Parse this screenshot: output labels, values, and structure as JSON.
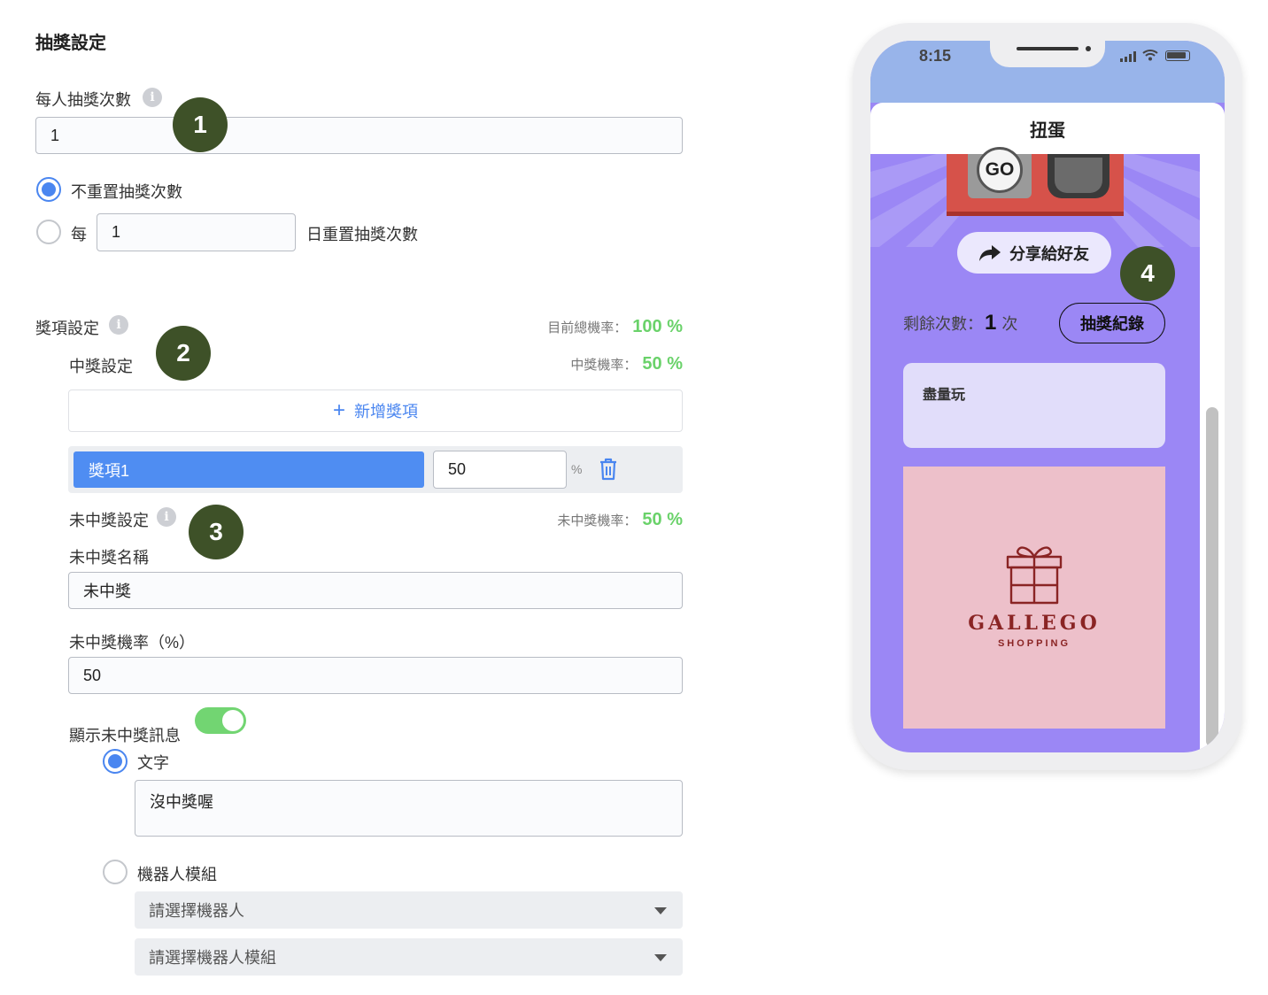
{
  "section_title": "抽獎設定",
  "draw_count": {
    "label": "每人抽獎次數",
    "value": "1",
    "option_no_reset": "不重置抽獎次數",
    "option_reset_prefix": "每",
    "reset_days_value": "1",
    "option_reset_suffix": "日重置抽獎次數"
  },
  "prize_settings": {
    "title": "獎項設定",
    "total_rate_label": "目前總機率：",
    "total_rate_value": "100 %",
    "win_title": "中獎設定",
    "win_rate_label": "中獎機率：",
    "win_rate_value": "50 %",
    "add_prize_label": "新增獎項",
    "prizes": [
      {
        "name": "獎項1",
        "rate": "50",
        "unit": "%"
      }
    ]
  },
  "no_win": {
    "title": "未中獎設定",
    "rate_label": "未中獎機率：",
    "rate_value": "50 %",
    "name_label": "未中獎名稱",
    "name_value": "未中獎",
    "prob_label": "未中獎機率（%）",
    "prob_value": "50",
    "show_msg_label": "顯示未中獎訊息",
    "show_msg_enabled": true,
    "option_text": "文字",
    "text_value": "沒中獎喔",
    "option_bot": "機器人模組",
    "bot_select_placeholder": "請選擇機器人",
    "bot_module_select_placeholder": "請選擇機器人模組"
  },
  "markers": [
    "1",
    "2",
    "3",
    "4"
  ],
  "phone": {
    "time": "8:15",
    "title": "扭蛋",
    "go_label": "GO",
    "share_label": "分享給好友",
    "remaining_label": "剩餘次數：",
    "remaining_value": "1",
    "remaining_unit": "次",
    "history_button": "抽獎紀錄",
    "note_text": "盡量玩",
    "brand_name": "GALLEGO",
    "brand_sub": "SHOPPING"
  },
  "colors": {
    "accent_blue": "#4a86f0",
    "rate_green": "#6ad26a",
    "marker_green": "#3e5128",
    "phone_purple": "#9b87f5",
    "toggle_green": "#72d572"
  }
}
